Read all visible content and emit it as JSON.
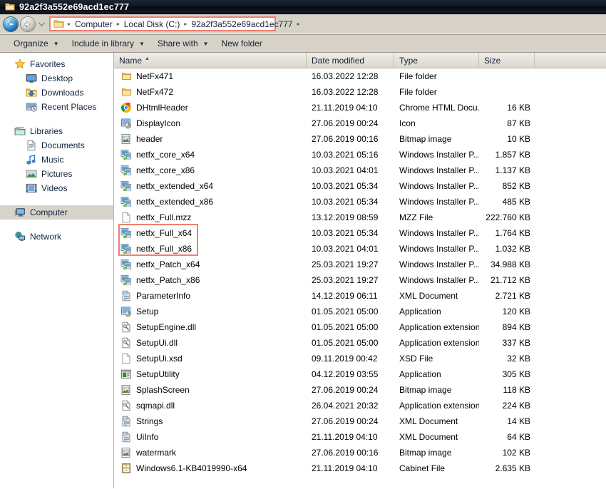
{
  "window": {
    "title": "92a2f3a552e69acd1ec777",
    "title_icon": "folder-icon"
  },
  "navbar": {
    "back_label": "Back",
    "forward_label": "Forward",
    "recent_label": "Recent pages",
    "address_icon": "folder-icon",
    "breadcrumbs": [
      "Computer",
      "Local Disk (C:)",
      "92a2f3a552e69acd1ec777"
    ],
    "highlight_color": "#ef7f70"
  },
  "commandbar": {
    "items": [
      {
        "label": "Organize",
        "has_caret": true
      },
      {
        "label": "Include in library",
        "has_caret": true
      },
      {
        "label": "Share with",
        "has_caret": true
      },
      {
        "label": "New folder",
        "has_caret": false
      }
    ]
  },
  "sidebar": {
    "groups": [
      {
        "root": {
          "label": "Favorites",
          "icon": "star-icon"
        },
        "children": [
          {
            "label": "Desktop",
            "icon": "desktop-icon"
          },
          {
            "label": "Downloads",
            "icon": "downloads-icon"
          },
          {
            "label": "Recent Places",
            "icon": "recent-places-icon"
          }
        ]
      },
      {
        "root": {
          "label": "Libraries",
          "icon": "libraries-icon"
        },
        "children": [
          {
            "label": "Documents",
            "icon": "document-icon"
          },
          {
            "label": "Music",
            "icon": "music-icon"
          },
          {
            "label": "Pictures",
            "icon": "pictures-icon"
          },
          {
            "label": "Videos",
            "icon": "videos-icon"
          }
        ]
      },
      {
        "root": {
          "label": "Computer",
          "icon": "computer-icon",
          "selected": true
        },
        "children": []
      },
      {
        "root": {
          "label": "Network",
          "icon": "network-icon"
        },
        "children": []
      }
    ]
  },
  "filelist": {
    "columns": [
      {
        "label": "Name",
        "sorted": true,
        "sort_dir": "asc"
      },
      {
        "label": "Date modified"
      },
      {
        "label": "Type"
      },
      {
        "label": "Size"
      },
      {
        "label": ""
      }
    ],
    "highlighted_rows": [
      "netfx_Full_x64",
      "netfx_Full_x86"
    ],
    "rows": [
      {
        "name": "NetFx471",
        "date": "16.03.2022 12:28",
        "type": "File folder",
        "size": "",
        "icon": "folder-icon"
      },
      {
        "name": "NetFx472",
        "date": "16.03.2022 12:28",
        "type": "File folder",
        "size": "",
        "icon": "folder-icon"
      },
      {
        "name": "DHtmlHeader",
        "date": "21.11.2019 04:10",
        "type": "Chrome HTML Docu...",
        "size": "16 KB",
        "icon": "chrome-icon"
      },
      {
        "name": "DisplayIcon",
        "date": "27.06.2019 00:24",
        "type": "Icon",
        "size": "87 KB",
        "icon": "icon-file-icon"
      },
      {
        "name": "header",
        "date": "27.06.2019 00:16",
        "type": "Bitmap image",
        "size": "10 KB",
        "icon": "bitmap-icon"
      },
      {
        "name": "netfx_core_x64",
        "date": "10.03.2021 05:16",
        "type": "Windows Installer P...",
        "size": "1.857 KB",
        "icon": "msi-icon"
      },
      {
        "name": "netfx_core_x86",
        "date": "10.03.2021 04:01",
        "type": "Windows Installer P...",
        "size": "1.137 KB",
        "icon": "msi-icon"
      },
      {
        "name": "netfx_extended_x64",
        "date": "10.03.2021 05:34",
        "type": "Windows Installer P...",
        "size": "852 KB",
        "icon": "msi-icon"
      },
      {
        "name": "netfx_extended_x86",
        "date": "10.03.2021 05:34",
        "type": "Windows Installer P...",
        "size": "485 KB",
        "icon": "msi-icon"
      },
      {
        "name": "netfx_Full.mzz",
        "date": "13.12.2019 08:59",
        "type": "MZZ File",
        "size": "222.760 KB",
        "icon": "blank-file-icon"
      },
      {
        "name": "netfx_Full_x64",
        "date": "10.03.2021 05:34",
        "type": "Windows Installer P...",
        "size": "1.764 KB",
        "icon": "msi-icon"
      },
      {
        "name": "netfx_Full_x86",
        "date": "10.03.2021 04:01",
        "type": "Windows Installer P...",
        "size": "1.032 KB",
        "icon": "msi-icon"
      },
      {
        "name": "netfx_Patch_x64",
        "date": "25.03.2021 19:27",
        "type": "Windows Installer P...",
        "size": "34.988 KB",
        "icon": "msi-icon"
      },
      {
        "name": "netfx_Patch_x86",
        "date": "25.03.2021 19:27",
        "type": "Windows Installer P...",
        "size": "21.712 KB",
        "icon": "msi-icon"
      },
      {
        "name": "ParameterInfo",
        "date": "14.12.2019 06:11",
        "type": "XML Document",
        "size": "2.721 KB",
        "icon": "xml-icon"
      },
      {
        "name": "Setup",
        "date": "01.05.2021 05:00",
        "type": "Application",
        "size": "120 KB",
        "icon": "icon-file-icon"
      },
      {
        "name": "SetupEngine.dll",
        "date": "01.05.2021 05:00",
        "type": "Application extension",
        "size": "894 KB",
        "icon": "dll-icon"
      },
      {
        "name": "SetupUi.dll",
        "date": "01.05.2021 05:00",
        "type": "Application extension",
        "size": "337 KB",
        "icon": "dll-icon"
      },
      {
        "name": "SetupUi.xsd",
        "date": "09.11.2019 00:42",
        "type": "XSD File",
        "size": "32 KB",
        "icon": "blank-file-icon"
      },
      {
        "name": "SetupUtility",
        "date": "04.12.2019 03:55",
        "type": "Application",
        "size": "305 KB",
        "icon": "app-icon"
      },
      {
        "name": "SplashScreen",
        "date": "27.06.2019 00:24",
        "type": "Bitmap image",
        "size": "118 KB",
        "icon": "bitmap-icon"
      },
      {
        "name": "sqmapi.dll",
        "date": "26.04.2021 20:32",
        "type": "Application extension",
        "size": "224 KB",
        "icon": "dll-icon"
      },
      {
        "name": "Strings",
        "date": "27.06.2019 00:24",
        "type": "XML Document",
        "size": "14 KB",
        "icon": "xml-icon"
      },
      {
        "name": "UiInfo",
        "date": "21.11.2019 04:10",
        "type": "XML Document",
        "size": "64 KB",
        "icon": "xml-icon"
      },
      {
        "name": "watermark",
        "date": "27.06.2019 00:16",
        "type": "Bitmap image",
        "size": "102 KB",
        "icon": "bitmap-icon"
      },
      {
        "name": "Windows6.1-KB4019990-x64",
        "date": "21.11.2019 04:10",
        "type": "Cabinet File",
        "size": "2.635 KB",
        "icon": "cabinet-icon"
      }
    ]
  }
}
